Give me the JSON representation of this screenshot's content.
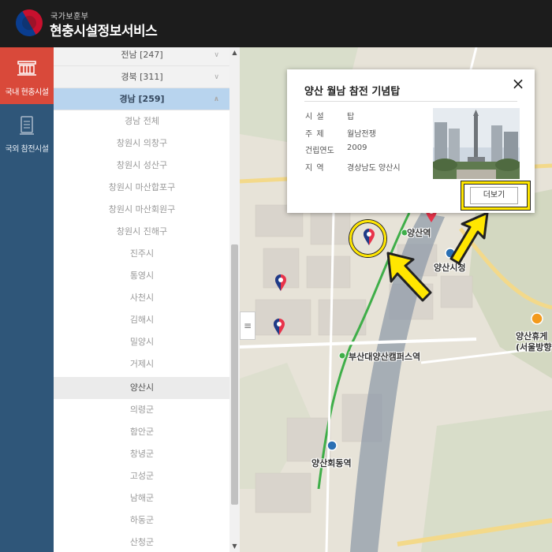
{
  "header": {
    "agency": "국가보훈부",
    "title": "현충시설정보서비스"
  },
  "nav": [
    {
      "label": "국내 현충시설",
      "icon": "building-icon",
      "active": true
    },
    {
      "label": "국외 참전시설",
      "icon": "document-icon",
      "active": false
    }
  ],
  "region_list": {
    "provinces": [
      {
        "label": "전남 [247]",
        "expanded": false
      },
      {
        "label": "경북 [311]",
        "expanded": false
      },
      {
        "label": "경남 [259]",
        "expanded": true
      }
    ],
    "districts": [
      "경남 전체",
      "창원시 의창구",
      "창원시 성산구",
      "창원시 마산합포구",
      "창원시 마산회원구",
      "창원시 진해구",
      "진주시",
      "통영시",
      "사천시",
      "김해시",
      "밀양시",
      "거제시",
      "양산시",
      "의령군",
      "함안군",
      "창녕군",
      "고성군",
      "남해군",
      "하동군",
      "산청군"
    ],
    "selected_district": "양산시",
    "chevron_collapsed": "∨",
    "chevron_expanded": "∧"
  },
  "map": {
    "labels": [
      "양산역",
      "양산시청",
      "부산대양산캠퍼스역",
      "양산회동역",
      "양산휴게",
      "(서울방향"
    ],
    "handle_icon": "≡"
  },
  "popup": {
    "title": "양산 월남 참전 기념탑",
    "close_icon": "×",
    "fields": [
      {
        "key": "시 설",
        "value": "탑"
      },
      {
        "key": "주 제",
        "value": "월남전쟁"
      },
      {
        "key": "건립연도",
        "value": "2009"
      },
      {
        "key": "지 역",
        "value": "경상남도 양산시"
      }
    ],
    "more_label": "더보기"
  },
  "colors": {
    "header_bg": "#1c1c1c",
    "nav_bg": "#2f5679",
    "nav_active": "#d9493a",
    "province_open_bg": "#b8d4ee",
    "highlight": "#ffe600",
    "pin_red": "#e8334a",
    "pin_blue": "#1f3c88"
  }
}
